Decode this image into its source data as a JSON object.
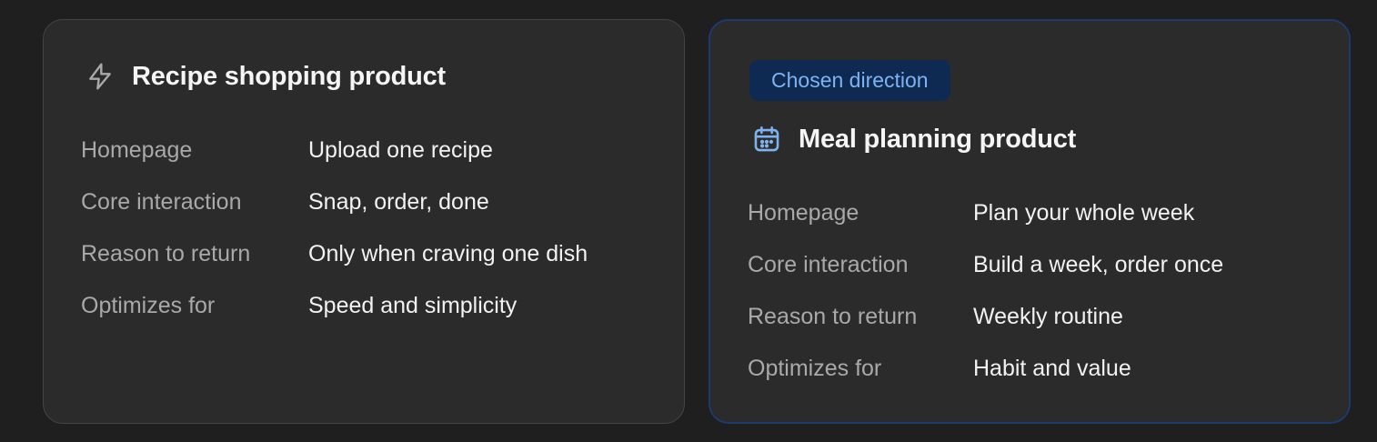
{
  "colors": {
    "background": "#1f1f1f",
    "card_background": "#2b2b2b",
    "card_border": "#444444",
    "selected_border": "#1d3a70",
    "badge_background": "#0e2a52",
    "badge_text": "#7fb3f0",
    "accent_icon": "#7fb3f0"
  },
  "left_card": {
    "icon": "lightning-bolt-icon",
    "title": "Recipe shopping product",
    "rows": [
      {
        "label": "Homepage",
        "value": "Upload one recipe"
      },
      {
        "label": "Core interaction",
        "value": "Snap, order, done"
      },
      {
        "label": "Reason to return",
        "value": "Only when craving one dish"
      },
      {
        "label": "Optimizes for",
        "value": "Speed and simplicity"
      }
    ]
  },
  "right_card": {
    "badge": "Chosen direction",
    "icon": "calendar-icon",
    "title": "Meal planning product",
    "rows": [
      {
        "label": "Homepage",
        "value": "Plan your whole week"
      },
      {
        "label": "Core interaction",
        "value": "Build a week, order once"
      },
      {
        "label": "Reason to return",
        "value": "Weekly routine"
      },
      {
        "label": "Optimizes for",
        "value": "Habit and value"
      }
    ]
  }
}
